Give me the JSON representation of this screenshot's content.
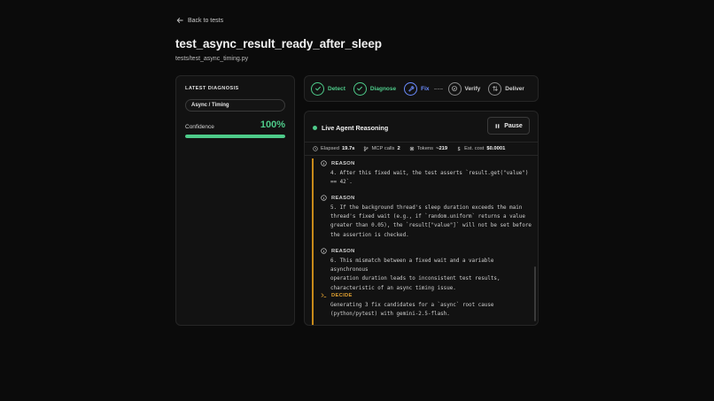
{
  "nav": {
    "back_label": "Back to tests"
  },
  "page": {
    "title": "test_async_result_ready_after_sleep",
    "file_path": "tests/test_async_timing.py"
  },
  "diagnosis": {
    "section_label": "LATEST DIAGNOSIS",
    "category": "Async / Timing",
    "confidence_label": "Confidence",
    "confidence_value": "100%",
    "confidence_fraction": 1.0
  },
  "pipeline": {
    "steps": [
      {
        "label": "Detect",
        "state": "done",
        "icon": "check-icon"
      },
      {
        "label": "Diagnose",
        "state": "done",
        "icon": "check-icon"
      },
      {
        "label": "Fix",
        "state": "active",
        "icon": "wrench-icon"
      },
      {
        "label": "Verify",
        "state": "pending",
        "icon": "shield-check-icon"
      },
      {
        "label": "Deliver",
        "state": "pending",
        "icon": "transfer-icon"
      }
    ]
  },
  "reasoning": {
    "title": "Live Agent Reasoning",
    "pause_label": "Pause",
    "stats": {
      "elapsed_label": "Elapsed",
      "elapsed_value": "19.7s",
      "mcp_label": "MCP calls",
      "mcp_value": "2",
      "tokens_label": "Tokens",
      "tokens_value": "~219",
      "cost_label": "Est. cost",
      "cost_value": "$0.0001"
    },
    "entries": [
      {
        "type": "REASON",
        "text": "4. After this fixed wait, the test asserts `result.get(\"value\")\n== 42`."
      },
      {
        "type": "REASON",
        "text": "5. If the background thread's sleep duration exceeds the main\nthread's fixed wait (e.g., if `random.uniform` returns a value\ngreater than 0.05), the `result[\"value\"]` will not be set before\nthe assertion is checked."
      },
      {
        "type": "REASON",
        "text": "6. This mismatch between a fixed wait and a variable asynchronous\noperation duration leads to inconsistent test results,\ncharacteristic of an async timing issue."
      },
      {
        "type": "DECIDE",
        "text": "Generating 3 fix candidates for a `async` root cause\n(python/pytest) with gemini-2.5-flash."
      }
    ]
  },
  "colors": {
    "success": "#4ecb8a",
    "active": "#6b8cff",
    "decide": "#e0a030",
    "background": "#0b0b0b"
  }
}
